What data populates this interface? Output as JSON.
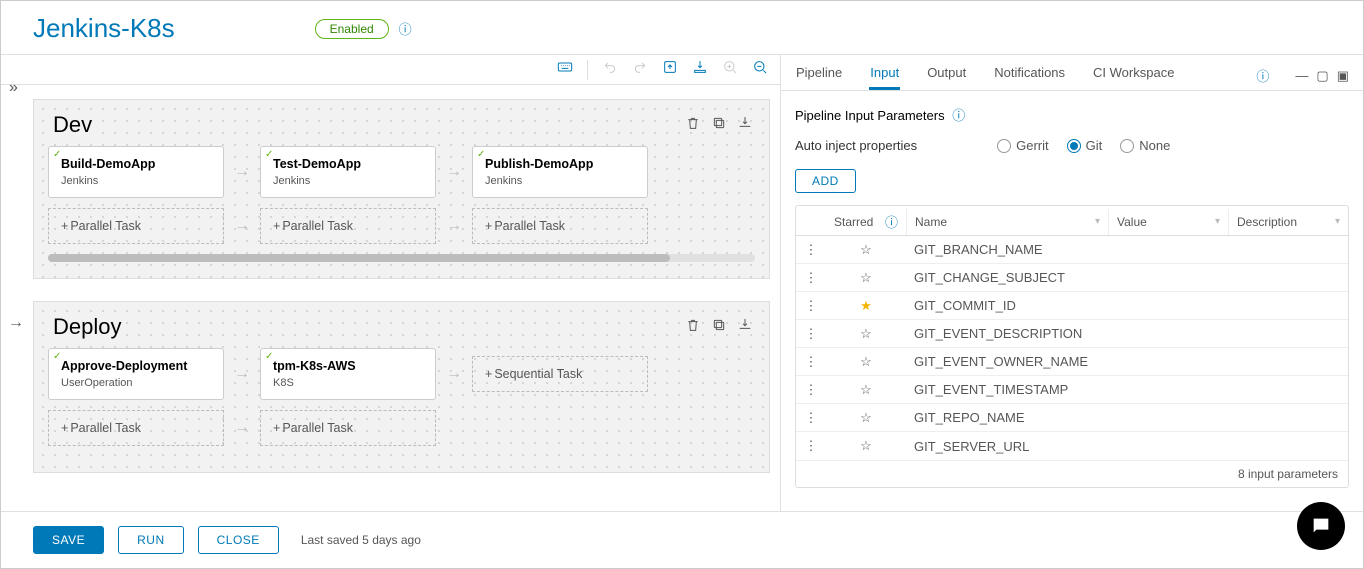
{
  "header": {
    "title": "Jenkins-K8s",
    "status": "Enabled"
  },
  "stages": [
    {
      "name": "Dev",
      "tasks": [
        {
          "name": "Build-DemoApp",
          "type": "Jenkins"
        },
        {
          "name": "Test-DemoApp",
          "type": "Jenkins"
        },
        {
          "name": "Publish-DemoApp",
          "type": "Jenkins"
        }
      ],
      "parallel_label": "Parallel Task",
      "show_scroll": true,
      "show_arrow": false
    },
    {
      "name": "Deploy",
      "tasks": [
        {
          "name": "Approve-Deployment",
          "type": "UserOperation"
        },
        {
          "name": "tpm-K8s-AWS",
          "type": "K8S"
        }
      ],
      "parallel_label": "Parallel Task",
      "sequential_label": "Sequential Task",
      "show_scroll": false,
      "show_arrow": true
    }
  ],
  "tabs": {
    "items": [
      "Pipeline",
      "Input",
      "Output",
      "Notifications",
      "CI Workspace"
    ],
    "active": "Input"
  },
  "panel": {
    "section_title": "Pipeline Input Parameters",
    "inject_label": "Auto inject properties",
    "radio_options": [
      "Gerrit",
      "Git",
      "None"
    ],
    "radio_selected": "Git",
    "add_label": "ADD",
    "columns": {
      "starred": "Starred",
      "name": "Name",
      "value": "Value",
      "description": "Description"
    },
    "rows": [
      {
        "name": "GIT_BRANCH_NAME",
        "value": "",
        "description": "",
        "starred": false
      },
      {
        "name": "GIT_CHANGE_SUBJECT",
        "value": "",
        "description": "",
        "starred": false
      },
      {
        "name": "GIT_COMMIT_ID",
        "value": "",
        "description": "",
        "starred": true
      },
      {
        "name": "GIT_EVENT_DESCRIPTION",
        "value": "",
        "description": "",
        "starred": false
      },
      {
        "name": "GIT_EVENT_OWNER_NAME",
        "value": "",
        "description": "",
        "starred": false
      },
      {
        "name": "GIT_EVENT_TIMESTAMP",
        "value": "",
        "description": "",
        "starred": false
      },
      {
        "name": "GIT_REPO_NAME",
        "value": "",
        "description": "",
        "starred": false
      },
      {
        "name": "GIT_SERVER_URL",
        "value": "",
        "description": "",
        "starred": false
      }
    ],
    "footer": "8 input parameters"
  },
  "footer": {
    "save": "SAVE",
    "run": "RUN",
    "close": "CLOSE",
    "last_saved": "Last saved 5 days ago"
  }
}
